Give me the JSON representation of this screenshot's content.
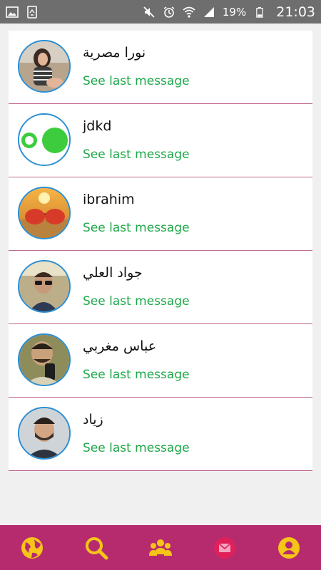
{
  "status_bar": {
    "battery": "19%",
    "time": "21:03",
    "icons": [
      "gallery-icon",
      "recycle-icon",
      "mute-icon",
      "alarm-icon",
      "wifi-icon",
      "signal-icon",
      "battery-icon"
    ]
  },
  "chats": [
    {
      "name": "نورا مصرية",
      "subtitle": "See last message",
      "avatar": "avatar-photo-woman"
    },
    {
      "name": "jdkd",
      "subtitle": "See last message",
      "avatar": "avatar-green-circles"
    },
    {
      "name": "ibrahim",
      "subtitle": "See last message",
      "avatar": "avatar-sunglasses-beach"
    },
    {
      "name": "جواد العلي",
      "subtitle": "See last message",
      "avatar": "avatar-photo-man-sunglasses"
    },
    {
      "name": "عباس مغربي",
      "subtitle": "See last message",
      "avatar": "avatar-photo-man-phone"
    },
    {
      "name": "زياد",
      "subtitle": "See last message",
      "avatar": "avatar-photo-man-beard"
    }
  ],
  "bottom_nav": {
    "items": [
      "globe-icon",
      "search-icon",
      "group-icon",
      "messages-icon",
      "profile-icon"
    ],
    "bar_color": "#b62b6e",
    "icon_color": "#f5c518",
    "active_icon_color": "#e0205a"
  },
  "colors": {
    "subtitle": "#1fa84a",
    "divider": "#c06890",
    "avatar_border": "#2a8fd4"
  }
}
